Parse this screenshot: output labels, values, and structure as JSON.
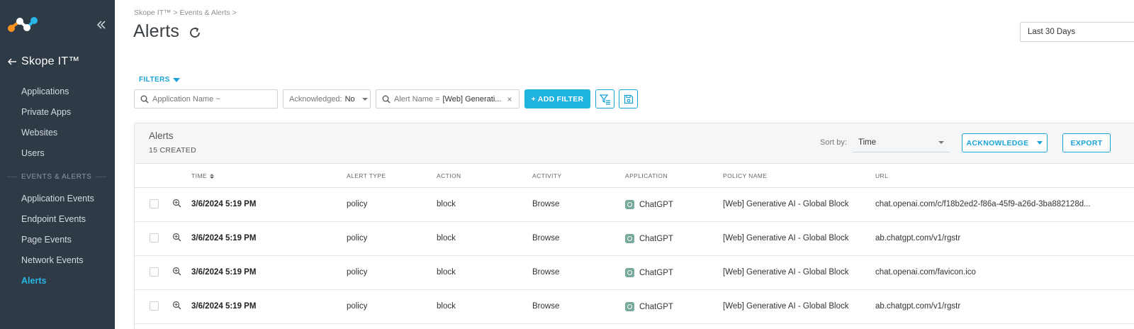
{
  "sidebar": {
    "product": "Skope IT™",
    "items": [
      {
        "label": "Applications"
      },
      {
        "label": "Private Apps"
      },
      {
        "label": "Websites"
      },
      {
        "label": "Users"
      }
    ],
    "section_label": "EVENTS & ALERTS",
    "event_items": [
      {
        "label": "Application Events"
      },
      {
        "label": "Endpoint Events"
      },
      {
        "label": "Page Events"
      },
      {
        "label": "Network Events"
      },
      {
        "label": "Alerts",
        "active": true
      }
    ],
    "accent": "#29b6e6",
    "bg": "#2e3a45"
  },
  "header": {
    "breadcrumb": "Skope IT™ > Events & Alerts >",
    "title": "Alerts",
    "range": "Last 30 Days"
  },
  "filters": {
    "toggle_label": "FILTERS",
    "app_name_placeholder": "Application Name ~",
    "acknowledged_label": "Acknowledged:",
    "acknowledged_value": "No",
    "alert_name_label": "Alert Name =",
    "alert_name_value": "[Web] Generati...",
    "add_filter_label": "+ ADD FILTER"
  },
  "panel": {
    "title": "Alerts",
    "count": "15 CREATED",
    "sort_label": "Sort by:",
    "sort_value": "Time",
    "acknowledge_label": "ACKNOWLEDGE",
    "export_label": "EXPORT"
  },
  "table": {
    "columns": {
      "time": "TIME",
      "alert_type": "ALERT TYPE",
      "action": "ACTION",
      "activity": "ACTIVITY",
      "application": "APPLICATION",
      "policy_name": "POLICY NAME",
      "url": "URL"
    },
    "rows": [
      {
        "time": "3/6/2024 5:19 PM",
        "alert_type": "policy",
        "action": "block",
        "activity": "Browse",
        "application": "ChatGPT",
        "policy_name": "[Web] Generative AI - Global Block",
        "url": "chat.openai.com/c/f18b2ed2-f86a-45f9-a26d-3ba882128d..."
      },
      {
        "time": "3/6/2024 5:19 PM",
        "alert_type": "policy",
        "action": "block",
        "activity": "Browse",
        "application": "ChatGPT",
        "policy_name": "[Web] Generative AI - Global Block",
        "url": "ab.chatgpt.com/v1/rgstr"
      },
      {
        "time": "3/6/2024 5:19 PM",
        "alert_type": "policy",
        "action": "block",
        "activity": "Browse",
        "application": "ChatGPT",
        "policy_name": "[Web] Generative AI - Global Block",
        "url": "chat.openai.com/favicon.ico"
      },
      {
        "time": "3/6/2024 5:19 PM",
        "alert_type": "policy",
        "action": "block",
        "activity": "Browse",
        "application": "ChatGPT",
        "policy_name": "[Web] Generative AI - Global Block",
        "url": "ab.chatgpt.com/v1/rgstr"
      }
    ]
  }
}
